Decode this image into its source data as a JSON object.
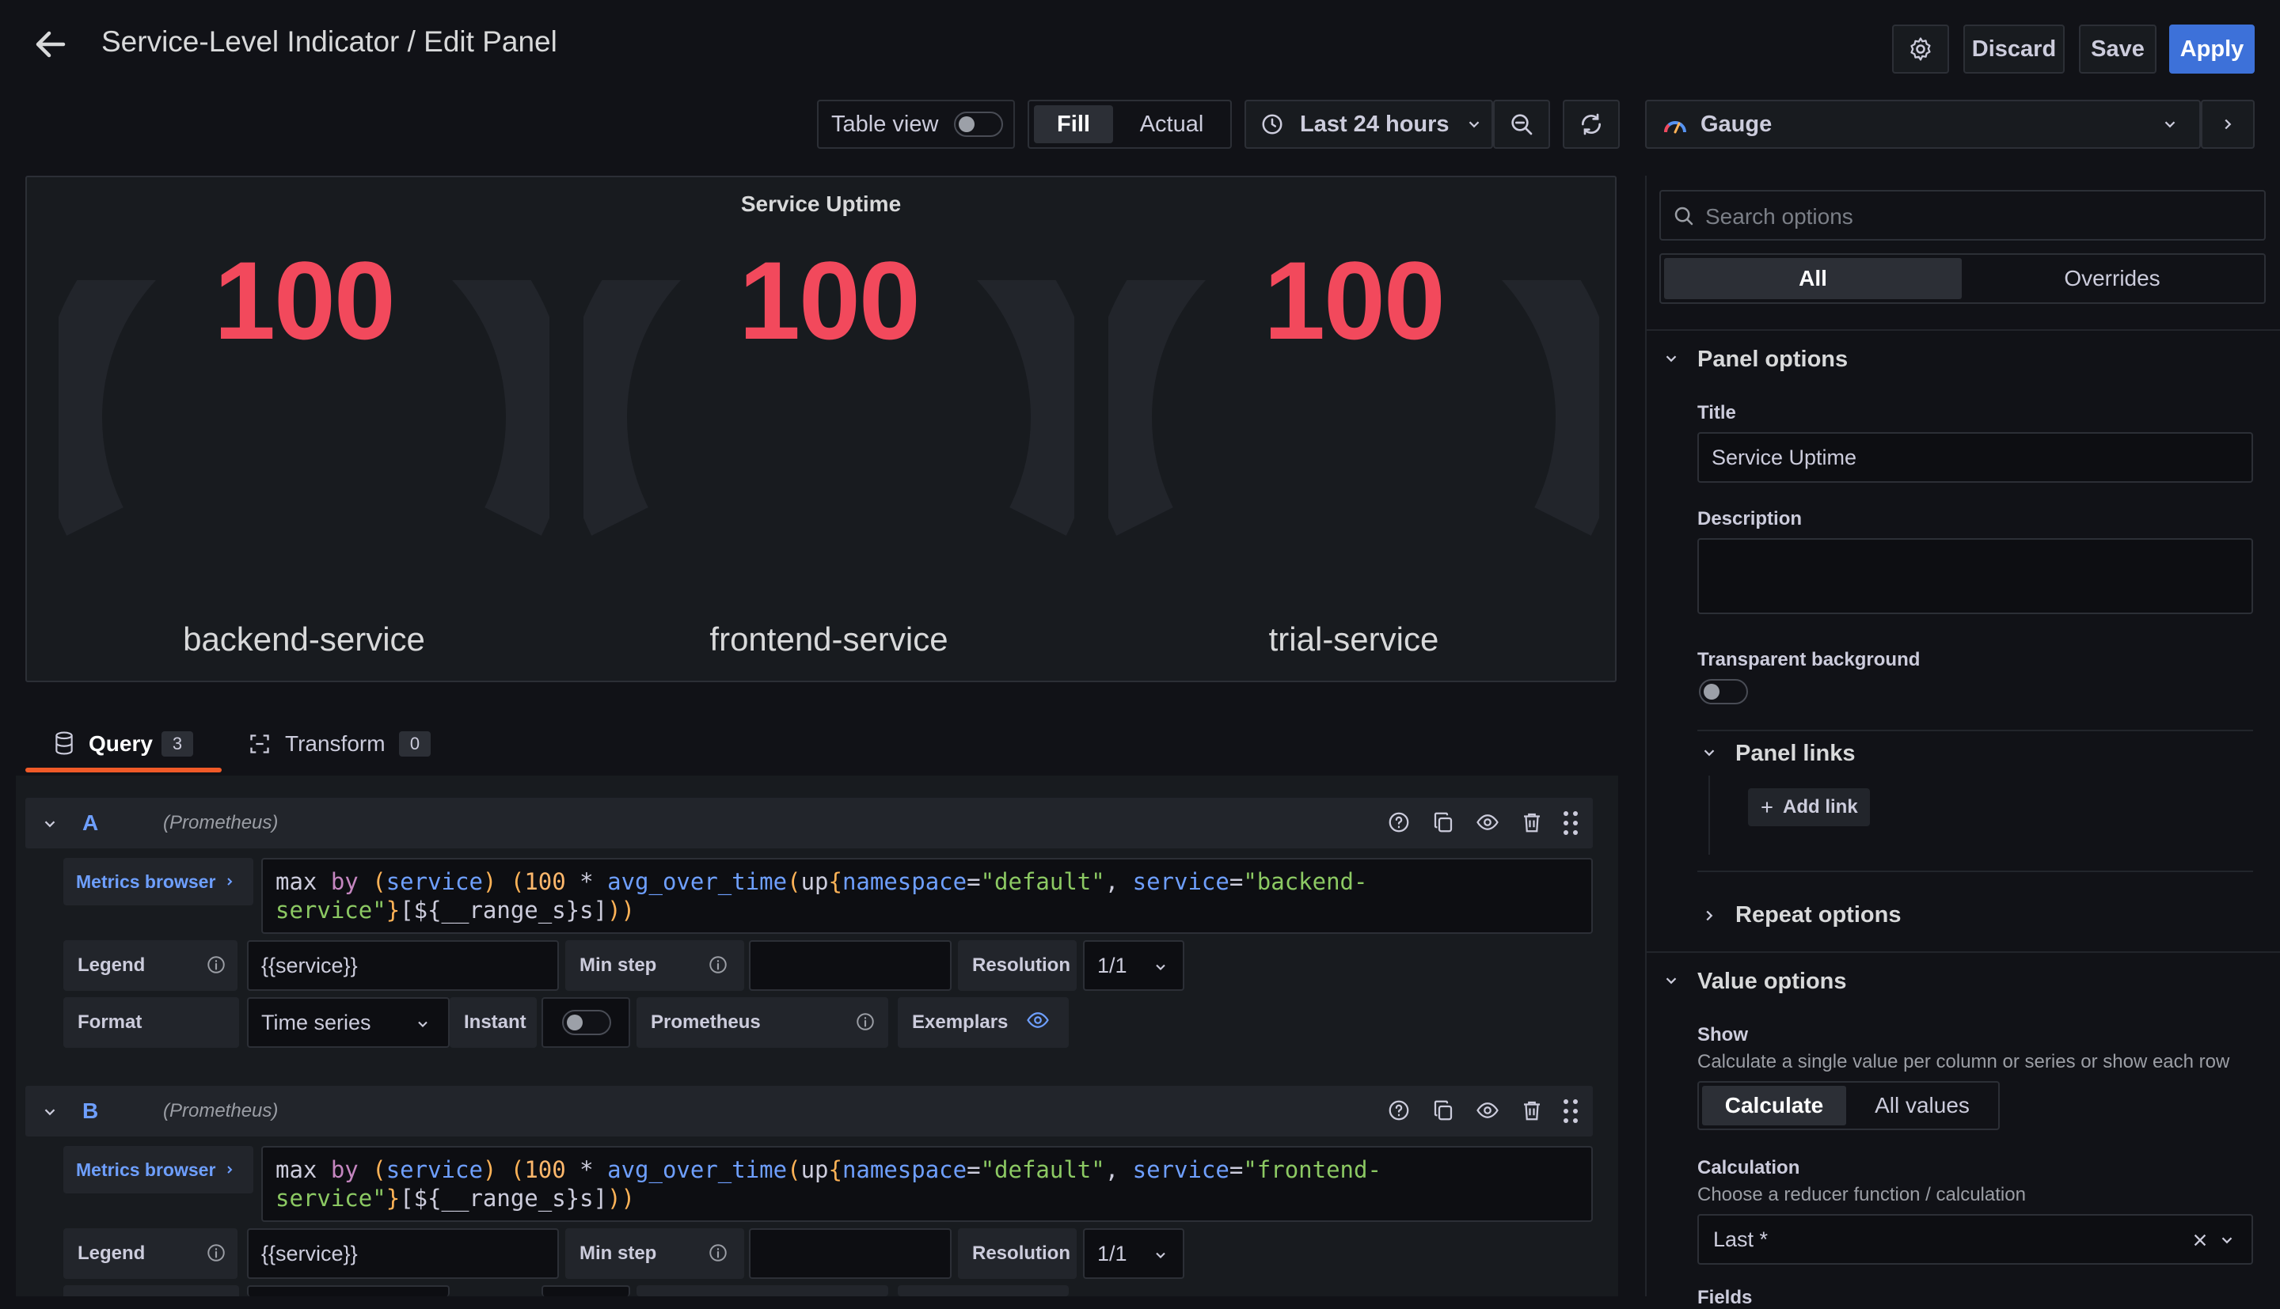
{
  "header": {
    "title": "Service-Level Indicator / Edit Panel",
    "discard": "Discard",
    "save": "Save",
    "apply": "Apply"
  },
  "toolbar": {
    "table_view": "Table view",
    "fill": "Fill",
    "actual": "Actual",
    "time_range": "Last 24 hours",
    "visualization": "Gauge"
  },
  "panel": {
    "title": "Service Uptime",
    "gauges": [
      {
        "value": "100",
        "label": "backend-service",
        "fraction": 1.0
      },
      {
        "value": "100",
        "label": "frontend-service",
        "fraction": 1.0
      },
      {
        "value": "100",
        "label": "trial-service",
        "fraction": 1.0
      }
    ]
  },
  "tabs": {
    "query": "Query",
    "query_count": "3",
    "transform": "Transform",
    "transform_count": "0"
  },
  "queries": [
    {
      "id": "A",
      "datasource": "(Prometheus)",
      "metrics_browser": "Metrics browser",
      "service": "backend-",
      "legend_value": "{{service}}",
      "resolution": "1/1",
      "format": "Time series"
    },
    {
      "id": "B",
      "datasource": "(Prometheus)",
      "metrics_browser": "Metrics browser",
      "service": "frontend-",
      "legend_value": "{{service}}",
      "resolution": "1/1"
    }
  ],
  "query_labels": {
    "legend": "Legend",
    "min_step": "Min step",
    "resolution": "Resolution",
    "format": "Format",
    "instant": "Instant",
    "prometheus": "Prometheus",
    "exemplars": "Exemplars"
  },
  "options": {
    "search_placeholder": "Search options",
    "tab_all": "All",
    "tab_overrides": "Overrides",
    "panel_options": "Panel options",
    "title_label": "Title",
    "title_value": "Service Uptime",
    "description_label": "Description",
    "transparent_bg": "Transparent background",
    "panel_links": "Panel links",
    "add_link": "Add link",
    "repeat_options": "Repeat options",
    "value_options": "Value options",
    "show_label": "Show",
    "show_help": "Calculate a single value per column or series or show each row",
    "calculate": "Calculate",
    "all_values": "All values",
    "calculation_label": "Calculation",
    "calculation_help": "Choose a reducer function / calculation",
    "calculation_value": "Last *",
    "fields_label": "Fields"
  },
  "colors": {
    "background": "#111217",
    "panel": "#181b1f",
    "accent": "#3d71d9",
    "value_red": "#f2495c",
    "gauge_track": "#22252b",
    "query_tab_underline": "#f05a28"
  }
}
